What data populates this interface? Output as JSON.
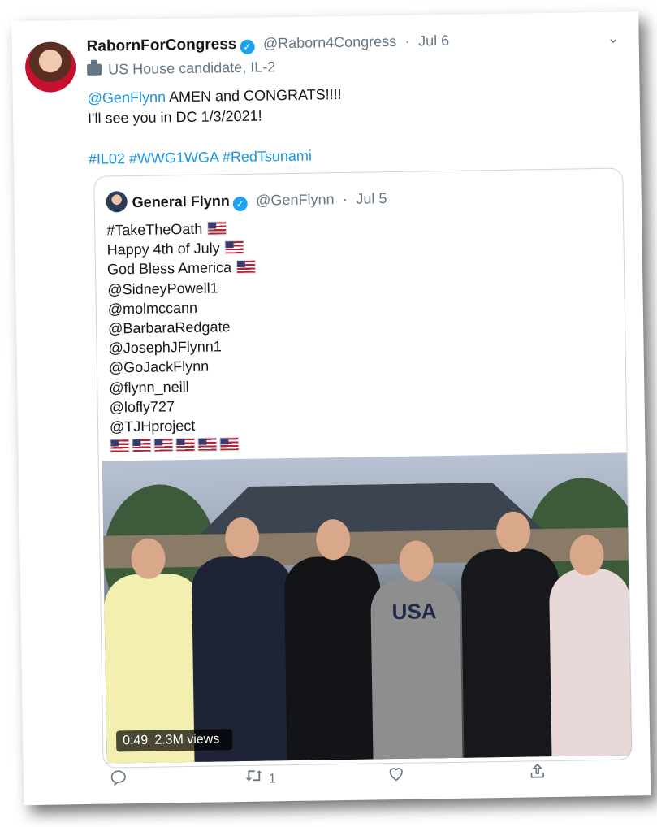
{
  "tweet": {
    "display_name": "RabornForCongress",
    "handle": "@Raborn4Congress",
    "separator": "·",
    "date": "Jul 6",
    "bio": "US House candidate, IL-2",
    "text_mention": "@GenFlynn",
    "text_line1": " AMEN and CONGRATS!!!!",
    "text_line2": "I'll see you in DC 1/3/2021!",
    "hashtags": "#IL02 #WWG1WGA #RedTsunami"
  },
  "quoted": {
    "display_name": "General Flynn",
    "handle": "@GenFlynn",
    "separator": "·",
    "date": "Jul 5",
    "lines": [
      "#TakeTheOath",
      "Happy 4th of July",
      "God Bless America",
      "@SidneyPowell1",
      "@molmccann",
      "@BarbaraRedgate",
      "@JosephJFlynn1",
      "@GoJackFlynn",
      "@flynn_neill",
      "@lofly727",
      "@TJHproject"
    ],
    "flag_count": 6,
    "video": {
      "duration": "0:49",
      "views": "2.3M views",
      "shirt_text": "USA"
    }
  },
  "actions": {
    "retweet_count": "1"
  },
  "icons": {
    "verified": "verified-check-icon",
    "reply": "reply-icon",
    "retweet": "retweet-icon",
    "like": "heart-icon",
    "share": "share-icon",
    "chevron": "chevron-down-icon"
  },
  "colors": {
    "link": "#1b95e0",
    "verified": "#1da1f2",
    "muted": "#657786"
  }
}
